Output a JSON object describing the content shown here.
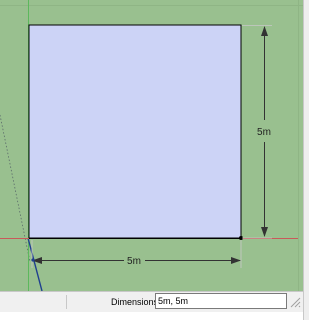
{
  "viewport": {
    "background_color": "#99c08f",
    "face_color": "#ccd3f6",
    "red_axis_color": "#c85a5a",
    "green_axis_color": "#5cb85c",
    "blue_axis_color": "#1f3f8f",
    "dimension_width": "5m",
    "dimension_depth": "5m"
  },
  "status_bar": {
    "vcb_label": "Dimensions",
    "vcb_value": "5m, 5m",
    "resize_grip_icon": "resize-grip-icon"
  }
}
